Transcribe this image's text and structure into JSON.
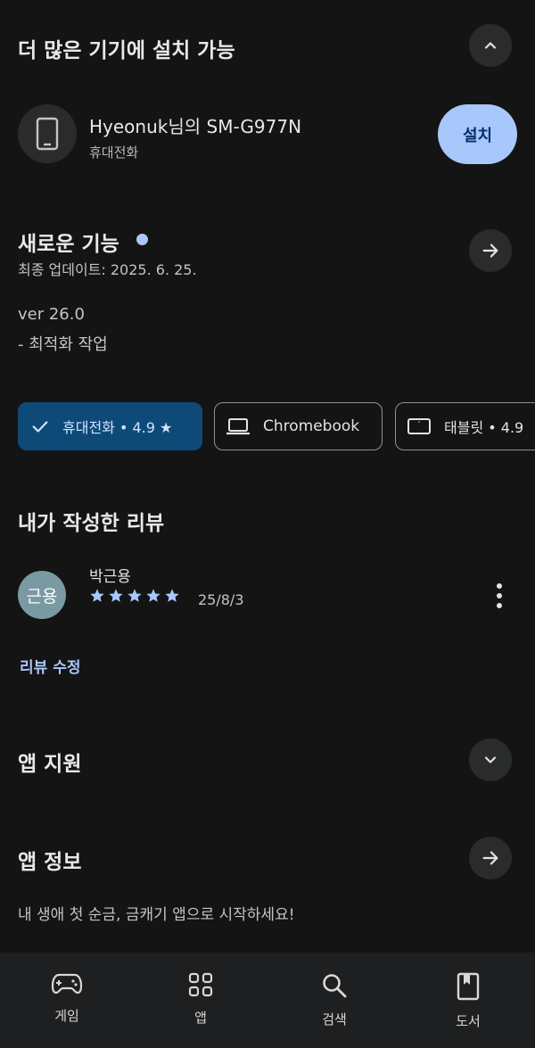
{
  "devices_section": {
    "title": "더 많은 기기에 설치 가능",
    "device_name": "Hyeonuk님의 SM-G977N",
    "device_type": "휴대전화",
    "install_label": "설치"
  },
  "whats_new": {
    "title": "새로운 기능",
    "last_updated": "최종 업데이트: 2025. 6. 25.",
    "version": "ver 26.0",
    "note": "- 최적화 작업"
  },
  "device_chips": [
    {
      "label": "휴대전화 • 4.9 ★",
      "selected": true,
      "icon": "check-icon"
    },
    {
      "label": "Chromebook",
      "selected": false,
      "icon": "laptop-icon"
    },
    {
      "label": "태블릿 • 4.9",
      "selected": false,
      "icon": "tablet-icon"
    }
  ],
  "my_review": {
    "title": "내가 작성한 리뷰",
    "avatar_text": "근용",
    "reviewer": "박근용",
    "rating": 5,
    "date": "25/8/3",
    "edit_label": "리뷰 수정"
  },
  "app_support": {
    "title": "앱 지원"
  },
  "app_info": {
    "title": "앱 정보",
    "description": "내 생애 첫 순금, 금캐기 앱으로 시작하세요!"
  },
  "bottom_nav": [
    {
      "label": "게임",
      "icon": "gamepad-icon"
    },
    {
      "label": "앱",
      "icon": "apps-grid-icon"
    },
    {
      "label": "검색",
      "icon": "search-icon"
    },
    {
      "label": "도서",
      "icon": "book-icon"
    }
  ],
  "colors": {
    "background": "#141414",
    "accent": "#a8c7fa",
    "chip_selected": "#0e4a78",
    "star": "#a8c7fa"
  }
}
